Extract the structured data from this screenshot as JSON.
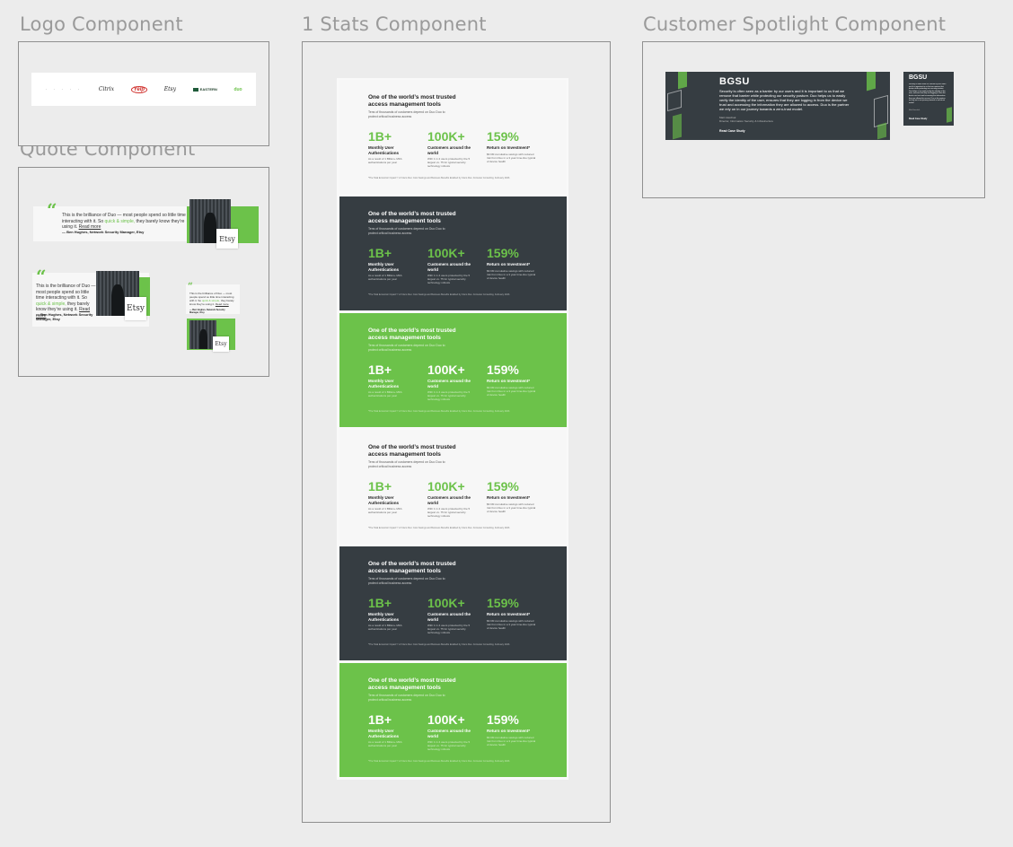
{
  "frames": {
    "logo": "Logo Component",
    "quote": "Quote Component",
    "stats": "1 Stats Component",
    "spotlight": "Customer Spotlight Component"
  },
  "logos": [
    {
      "name": "logo-dots",
      "label": "· · · · ·"
    },
    {
      "name": "logo-script",
      "label": "Citrix"
    },
    {
      "name": "logo-red",
      "label": "Yelp"
    },
    {
      "name": "logo-signature",
      "label": "Etsy"
    },
    {
      "name": "logo-eastern",
      "label": "EASTERN"
    },
    {
      "name": "logo-green",
      "label": "duo"
    }
  ],
  "quote": {
    "text_pre": "This is the brilliance of Duo — most people spend so little time interacting with it. So ",
    "text_hl": "quick & simple,",
    "text_post": " they barely know they’re using it. ",
    "read_more": "Read more",
    "author": "— Ben Hughes, Network Security Manager, Etsy",
    "brand": "Etsy"
  },
  "stats": {
    "heading": "One of the world’s most trusted access management tools",
    "subheading": "Tens of thousands of customers depend on Duo Duo to protect critical business access",
    "items": [
      {
        "num": "1B+",
        "label": "Monthly User Authentications",
        "desc": "As a result of 1 Billion+ MFA authentications per year"
      },
      {
        "num": "100K+",
        "label": "Customers around the world",
        "desc": "With 1 in 4 users protected by the 5 largest vs. 75 for typical security technology rollouts"
      },
      {
        "num": "159%",
        "label": "Return on Investment*",
        "desc": "$6.6M cumulative savings with reduced risk from Duo in a 3 year time-line typical of device health"
      }
    ],
    "footnote": "*The Total Economic Impact™ of Cisco Duo: Cost Savings and Business Benefits Enabled by Cisco Duo. Forrester Consulting. February 2023."
  },
  "spotlight": {
    "brand": "BGSU",
    "quote": "Security is often seen as a barrier by our users and it is important to us that we remove that barrier while protecting our security posture. Duo helps us to easily verify the identity of the user, ensures that they are logging in from the device we trust and accessing the information they are allowed to access. Duo is the partner we rely on in our journey towards a zero-trust model.",
    "author": "Matt Haschak",
    "role": "Director, Information Security & Infrastructure",
    "cta": "Read Case Study"
  },
  "colors": {
    "accent": "#6cc24a",
    "dark": "#363d42"
  }
}
